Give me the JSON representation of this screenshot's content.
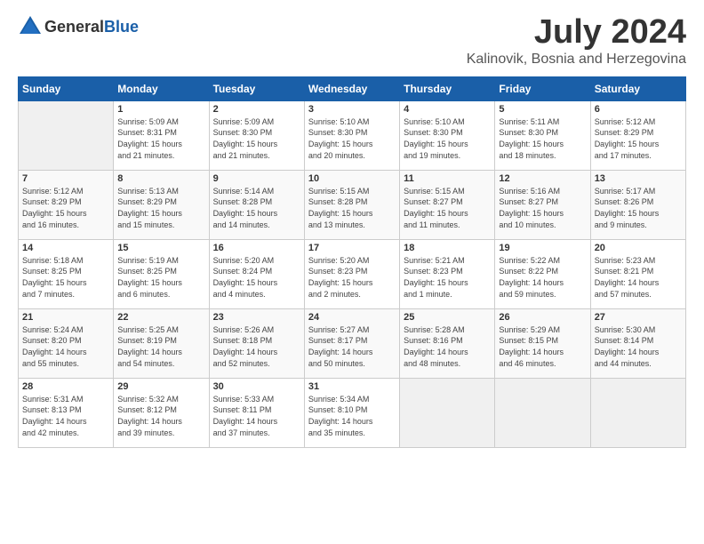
{
  "header": {
    "logo": {
      "general": "General",
      "blue": "Blue"
    },
    "title": "July 2024",
    "location": "Kalinovik, Bosnia and Herzegovina"
  },
  "days_of_week": [
    "Sunday",
    "Monday",
    "Tuesday",
    "Wednesday",
    "Thursday",
    "Friday",
    "Saturday"
  ],
  "weeks": [
    [
      {
        "day": "",
        "info": ""
      },
      {
        "day": "1",
        "info": "Sunrise: 5:09 AM\nSunset: 8:31 PM\nDaylight: 15 hours\nand 21 minutes."
      },
      {
        "day": "2",
        "info": "Sunrise: 5:09 AM\nSunset: 8:30 PM\nDaylight: 15 hours\nand 21 minutes."
      },
      {
        "day": "3",
        "info": "Sunrise: 5:10 AM\nSunset: 8:30 PM\nDaylight: 15 hours\nand 20 minutes."
      },
      {
        "day": "4",
        "info": "Sunrise: 5:10 AM\nSunset: 8:30 PM\nDaylight: 15 hours\nand 19 minutes."
      },
      {
        "day": "5",
        "info": "Sunrise: 5:11 AM\nSunset: 8:30 PM\nDaylight: 15 hours\nand 18 minutes."
      },
      {
        "day": "6",
        "info": "Sunrise: 5:12 AM\nSunset: 8:29 PM\nDaylight: 15 hours\nand 17 minutes."
      }
    ],
    [
      {
        "day": "7",
        "info": "Sunrise: 5:12 AM\nSunset: 8:29 PM\nDaylight: 15 hours\nand 16 minutes."
      },
      {
        "day": "8",
        "info": "Sunrise: 5:13 AM\nSunset: 8:29 PM\nDaylight: 15 hours\nand 15 minutes."
      },
      {
        "day": "9",
        "info": "Sunrise: 5:14 AM\nSunset: 8:28 PM\nDaylight: 15 hours\nand 14 minutes."
      },
      {
        "day": "10",
        "info": "Sunrise: 5:15 AM\nSunset: 8:28 PM\nDaylight: 15 hours\nand 13 minutes."
      },
      {
        "day": "11",
        "info": "Sunrise: 5:15 AM\nSunset: 8:27 PM\nDaylight: 15 hours\nand 11 minutes."
      },
      {
        "day": "12",
        "info": "Sunrise: 5:16 AM\nSunset: 8:27 PM\nDaylight: 15 hours\nand 10 minutes."
      },
      {
        "day": "13",
        "info": "Sunrise: 5:17 AM\nSunset: 8:26 PM\nDaylight: 15 hours\nand 9 minutes."
      }
    ],
    [
      {
        "day": "14",
        "info": "Sunrise: 5:18 AM\nSunset: 8:25 PM\nDaylight: 15 hours\nand 7 minutes."
      },
      {
        "day": "15",
        "info": "Sunrise: 5:19 AM\nSunset: 8:25 PM\nDaylight: 15 hours\nand 6 minutes."
      },
      {
        "day": "16",
        "info": "Sunrise: 5:20 AM\nSunset: 8:24 PM\nDaylight: 15 hours\nand 4 minutes."
      },
      {
        "day": "17",
        "info": "Sunrise: 5:20 AM\nSunset: 8:23 PM\nDaylight: 15 hours\nand 2 minutes."
      },
      {
        "day": "18",
        "info": "Sunrise: 5:21 AM\nSunset: 8:23 PM\nDaylight: 15 hours\nand 1 minute."
      },
      {
        "day": "19",
        "info": "Sunrise: 5:22 AM\nSunset: 8:22 PM\nDaylight: 14 hours\nand 59 minutes."
      },
      {
        "day": "20",
        "info": "Sunrise: 5:23 AM\nSunset: 8:21 PM\nDaylight: 14 hours\nand 57 minutes."
      }
    ],
    [
      {
        "day": "21",
        "info": "Sunrise: 5:24 AM\nSunset: 8:20 PM\nDaylight: 14 hours\nand 55 minutes."
      },
      {
        "day": "22",
        "info": "Sunrise: 5:25 AM\nSunset: 8:19 PM\nDaylight: 14 hours\nand 54 minutes."
      },
      {
        "day": "23",
        "info": "Sunrise: 5:26 AM\nSunset: 8:18 PM\nDaylight: 14 hours\nand 52 minutes."
      },
      {
        "day": "24",
        "info": "Sunrise: 5:27 AM\nSunset: 8:17 PM\nDaylight: 14 hours\nand 50 minutes."
      },
      {
        "day": "25",
        "info": "Sunrise: 5:28 AM\nSunset: 8:16 PM\nDaylight: 14 hours\nand 48 minutes."
      },
      {
        "day": "26",
        "info": "Sunrise: 5:29 AM\nSunset: 8:15 PM\nDaylight: 14 hours\nand 46 minutes."
      },
      {
        "day": "27",
        "info": "Sunrise: 5:30 AM\nSunset: 8:14 PM\nDaylight: 14 hours\nand 44 minutes."
      }
    ],
    [
      {
        "day": "28",
        "info": "Sunrise: 5:31 AM\nSunset: 8:13 PM\nDaylight: 14 hours\nand 42 minutes."
      },
      {
        "day": "29",
        "info": "Sunrise: 5:32 AM\nSunset: 8:12 PM\nDaylight: 14 hours\nand 39 minutes."
      },
      {
        "day": "30",
        "info": "Sunrise: 5:33 AM\nSunset: 8:11 PM\nDaylight: 14 hours\nand 37 minutes."
      },
      {
        "day": "31",
        "info": "Sunrise: 5:34 AM\nSunset: 8:10 PM\nDaylight: 14 hours\nand 35 minutes."
      },
      {
        "day": "",
        "info": ""
      },
      {
        "day": "",
        "info": ""
      },
      {
        "day": "",
        "info": ""
      }
    ]
  ]
}
